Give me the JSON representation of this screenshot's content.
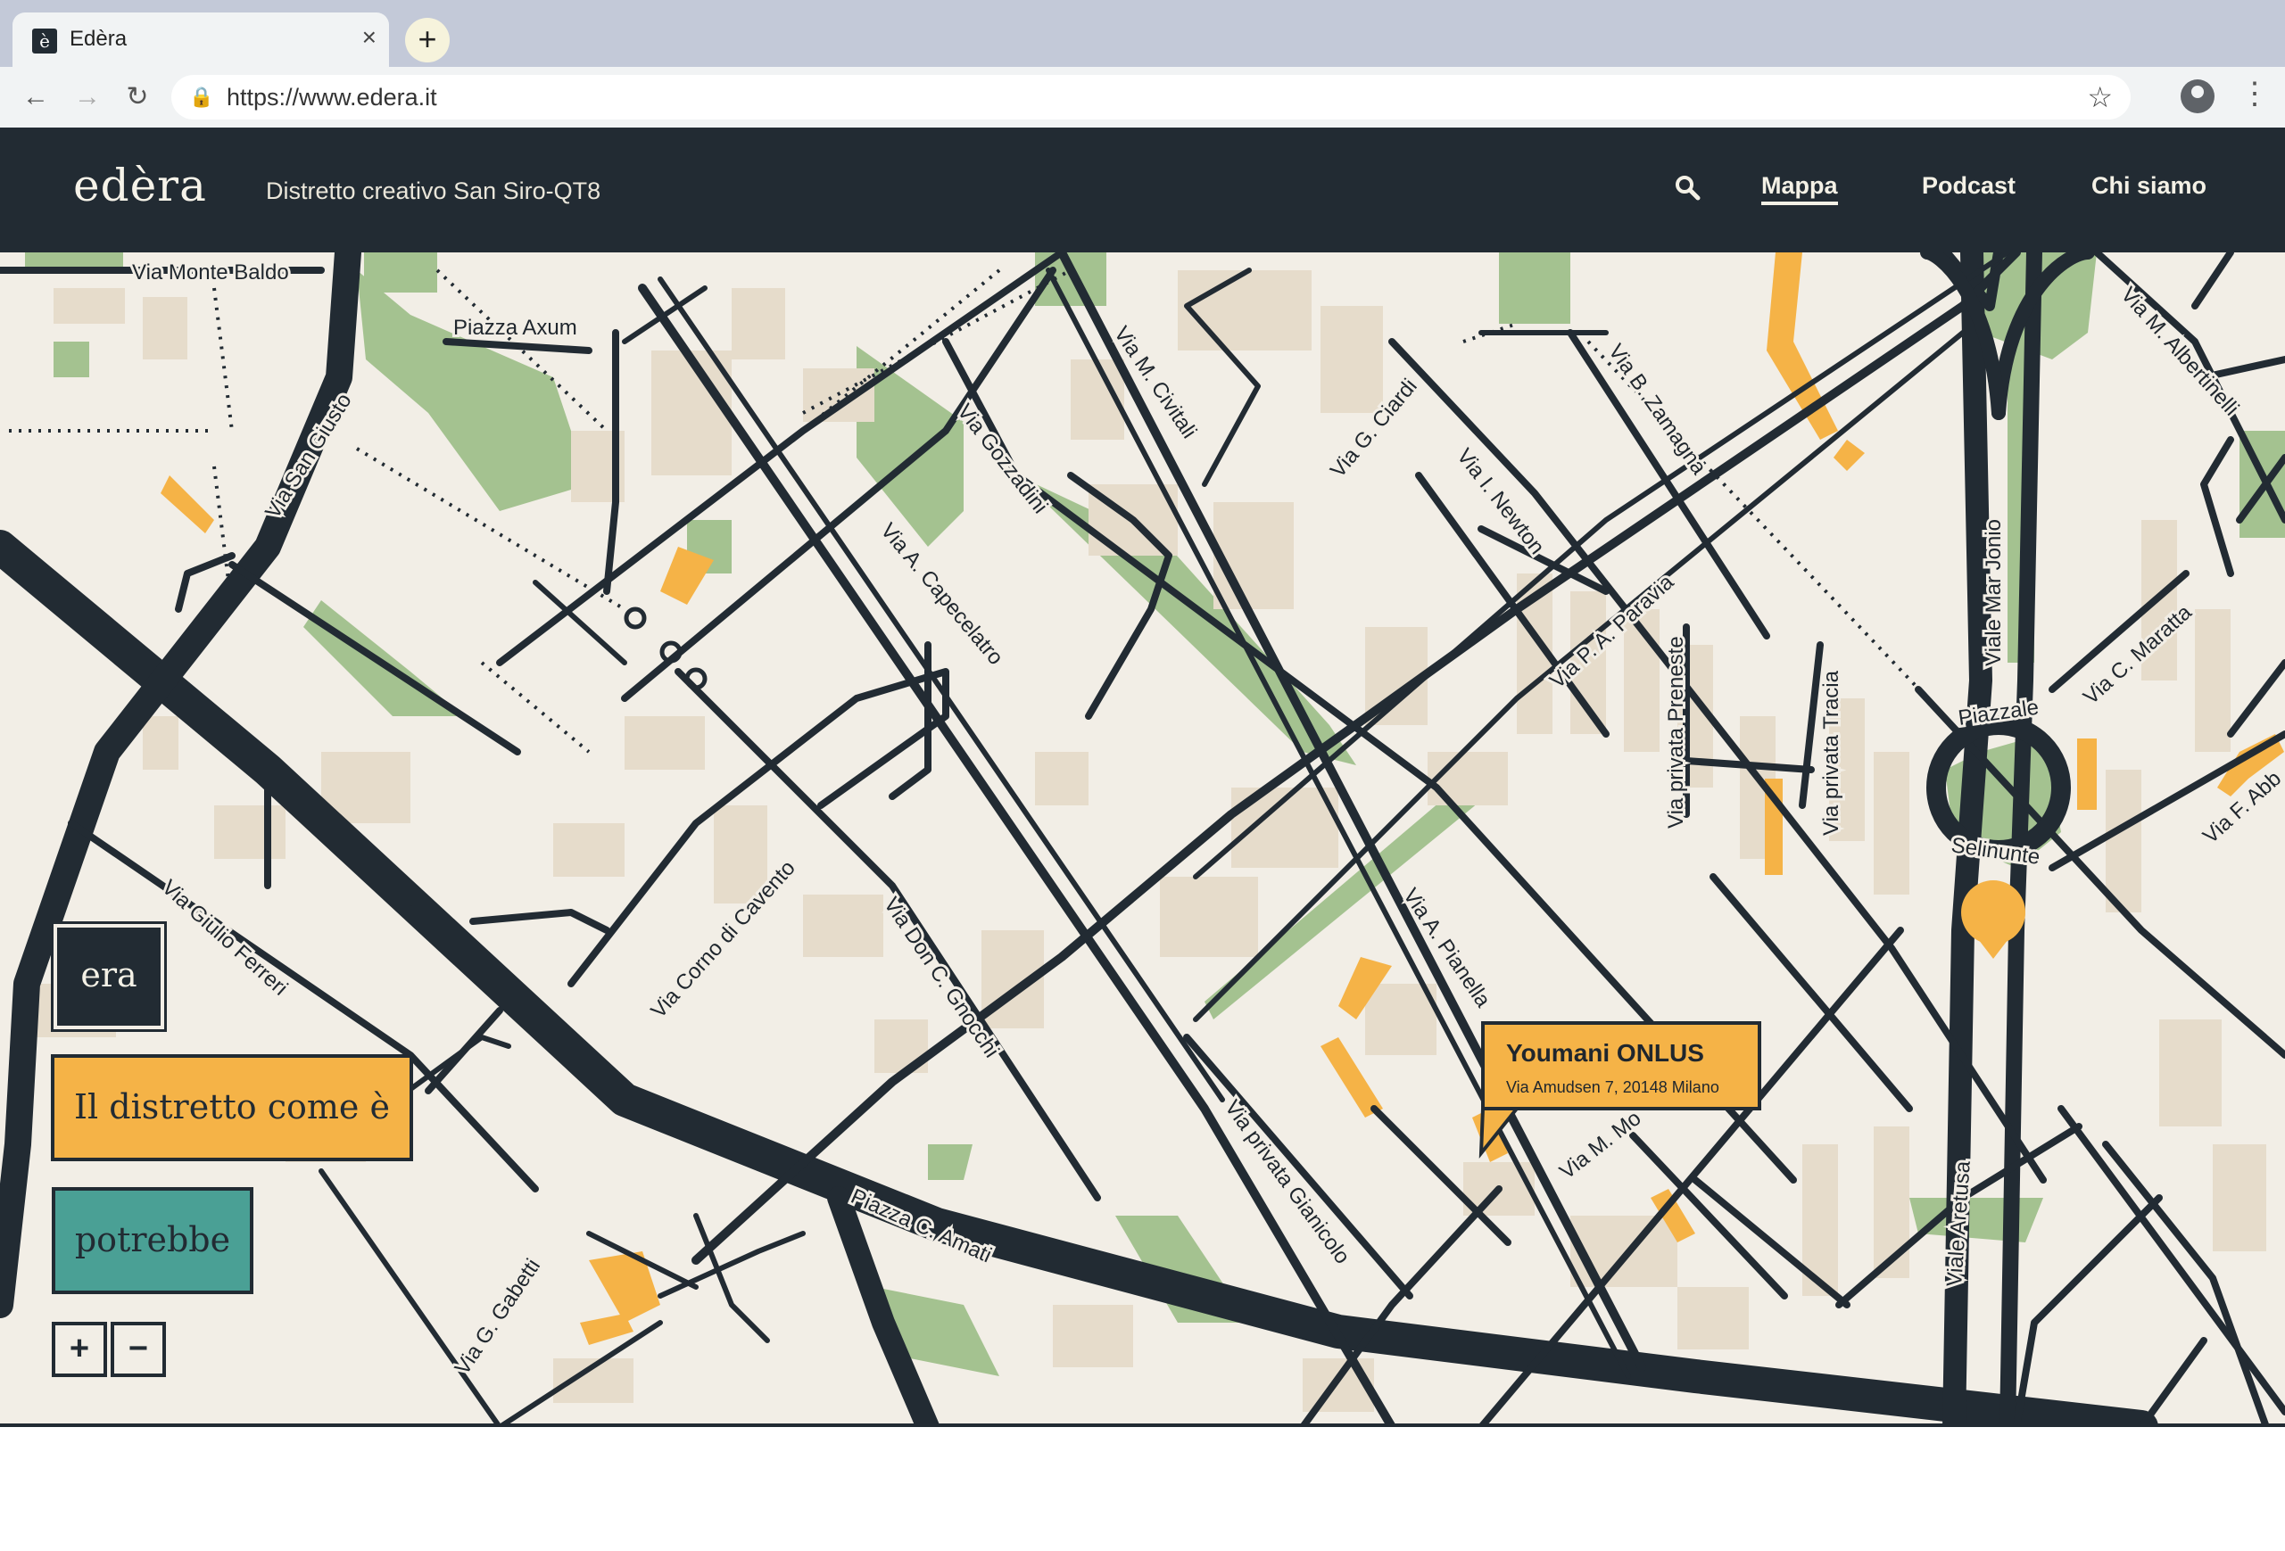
{
  "browser": {
    "tab_title": "Edèra",
    "tab_favicon": "è",
    "close_glyph": "×",
    "newtab_glyph": "+",
    "url": "https://www.edera.it"
  },
  "site": {
    "logo": "edèra",
    "tagline": "Distretto creativo San Siro-QT8",
    "nav": [
      "Mappa",
      "Podcast",
      "Chi siamo"
    ]
  },
  "map": {
    "streets": {
      "monte_baldo": "Via Monte Baldo",
      "axum": "Piazza Axum",
      "san_giusto": "Via San Giusto",
      "civitali": "Via M. Civitali",
      "gozzadini": "Via Gozzadini",
      "capecelatro": "Via A. Capecelatro",
      "ciardi": "Via G. Ciardi",
      "newton": "Via I. Newton",
      "zamagna": "Via B. Zamagna",
      "paravia": "Via P. A. Paravia",
      "preneste": "Via privata Preneste",
      "tracia": "Via privata Tracia",
      "mar_jonio": "Viale Mar Jonio",
      "albertinelli": "Via M. Albertinelli",
      "maratta": "Via C. Maratta",
      "abb": "Via F. Abb",
      "piazzale": "Piazzale",
      "selinunte": "Selinunte",
      "giulio_ferreri": "Via Giulio Ferreri",
      "corno_cavento": "Via Corno di Cavento",
      "gnocchi": "Via Don C. Gnocchi",
      "pianella": "Via A. Pianella",
      "mo": "Via M. Mo",
      "gianicolo": "Via privata Gianicolo",
      "amati": "Piazza C. Amati",
      "gabetti": "Via G. Gabetti",
      "aretusa": "Viale Aretusa"
    },
    "time_buttons": {
      "era": "era",
      "come_e": "Il distretto come è",
      "potrebbe": "potrebbe"
    },
    "zoom": {
      "in": "+",
      "out": "−"
    },
    "popup": {
      "title": "Youmani ONLUS",
      "address": "Via Amudsen 7, 20148 Milano"
    }
  },
  "colors": {
    "dark": "#222b33",
    "ground": "#f2eee6",
    "building": "#e6dccb",
    "park": "#a4c290",
    "highlight": "#f5b347",
    "teal": "#4aa095"
  }
}
